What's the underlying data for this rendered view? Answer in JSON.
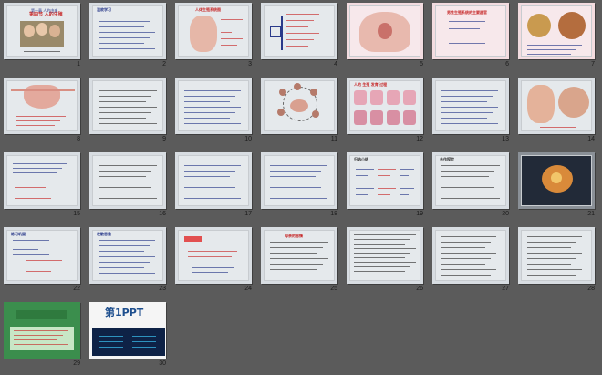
{
  "slides": [
    {
      "num": "1",
      "theme": "photo",
      "title": "第四节 人的生殖",
      "subtitle": "第一章 人的由来"
    },
    {
      "num": "2",
      "theme": "text-blue",
      "title": "温故学习"
    },
    {
      "num": "3",
      "theme": "anatomy",
      "title": "人体生殖系统图"
    },
    {
      "num": "4",
      "theme": "tree"
    },
    {
      "num": "5",
      "theme": "pelvis"
    },
    {
      "num": "6",
      "theme": "qa",
      "title": "男性生殖系统的主要器官"
    },
    {
      "num": "7",
      "theme": "cells"
    },
    {
      "num": "8",
      "theme": "uterus"
    },
    {
      "num": "9",
      "theme": "text-dark"
    },
    {
      "num": "10",
      "theme": "text-blue"
    },
    {
      "num": "11",
      "theme": "diagram-circle"
    },
    {
      "num": "12",
      "theme": "grid-pink",
      "title": "人的 生殖 发育 过程"
    },
    {
      "num": "13",
      "theme": "text-blue"
    },
    {
      "num": "14",
      "theme": "embryo"
    },
    {
      "num": "15",
      "theme": "text-red"
    },
    {
      "num": "16",
      "theme": "text-dark"
    },
    {
      "num": "17",
      "theme": "text-blue"
    },
    {
      "num": "18",
      "theme": "text-blue"
    },
    {
      "num": "19",
      "theme": "flow",
      "title": "归纳小结"
    },
    {
      "num": "20",
      "theme": "text-dark",
      "title": "合作探究"
    },
    {
      "num": "21",
      "theme": "egg"
    },
    {
      "num": "22",
      "theme": "text-list",
      "title": "练习巩固"
    },
    {
      "num": "23",
      "theme": "text-blue",
      "title": "发散思维"
    },
    {
      "num": "24",
      "theme": "question"
    },
    {
      "num": "25",
      "theme": "poem",
      "title": "母亲的恩情"
    },
    {
      "num": "26",
      "theme": "dense"
    },
    {
      "num": "27",
      "theme": "lines"
    },
    {
      "num": "28",
      "theme": "lines"
    },
    {
      "num": "29",
      "theme": "green"
    },
    {
      "num": "30",
      "theme": "logo",
      "title": "第1PPT"
    }
  ]
}
